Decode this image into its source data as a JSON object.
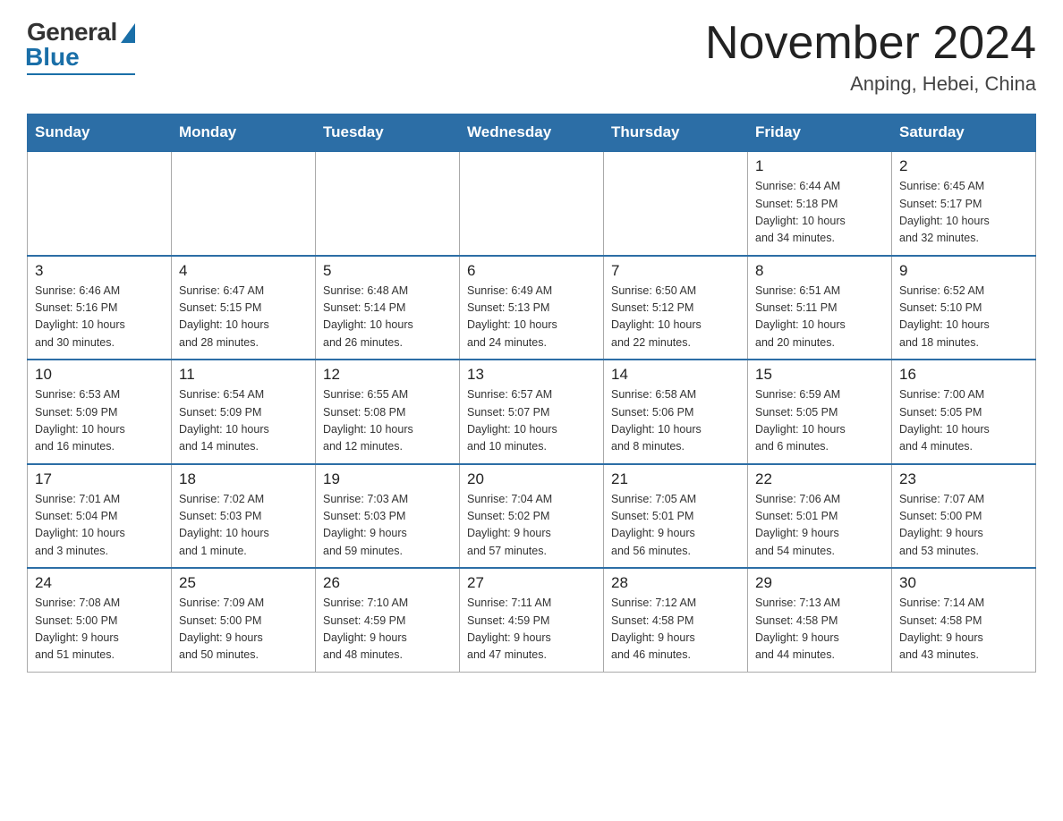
{
  "header": {
    "logo": {
      "general_text": "General",
      "blue_text": "Blue"
    },
    "month_title": "November 2024",
    "location": "Anping, Hebei, China"
  },
  "weekdays": [
    "Sunday",
    "Monday",
    "Tuesday",
    "Wednesday",
    "Thursday",
    "Friday",
    "Saturday"
  ],
  "weeks": [
    [
      {
        "day": "",
        "info": ""
      },
      {
        "day": "",
        "info": ""
      },
      {
        "day": "",
        "info": ""
      },
      {
        "day": "",
        "info": ""
      },
      {
        "day": "",
        "info": ""
      },
      {
        "day": "1",
        "info": "Sunrise: 6:44 AM\nSunset: 5:18 PM\nDaylight: 10 hours\nand 34 minutes."
      },
      {
        "day": "2",
        "info": "Sunrise: 6:45 AM\nSunset: 5:17 PM\nDaylight: 10 hours\nand 32 minutes."
      }
    ],
    [
      {
        "day": "3",
        "info": "Sunrise: 6:46 AM\nSunset: 5:16 PM\nDaylight: 10 hours\nand 30 minutes."
      },
      {
        "day": "4",
        "info": "Sunrise: 6:47 AM\nSunset: 5:15 PM\nDaylight: 10 hours\nand 28 minutes."
      },
      {
        "day": "5",
        "info": "Sunrise: 6:48 AM\nSunset: 5:14 PM\nDaylight: 10 hours\nand 26 minutes."
      },
      {
        "day": "6",
        "info": "Sunrise: 6:49 AM\nSunset: 5:13 PM\nDaylight: 10 hours\nand 24 minutes."
      },
      {
        "day": "7",
        "info": "Sunrise: 6:50 AM\nSunset: 5:12 PM\nDaylight: 10 hours\nand 22 minutes."
      },
      {
        "day": "8",
        "info": "Sunrise: 6:51 AM\nSunset: 5:11 PM\nDaylight: 10 hours\nand 20 minutes."
      },
      {
        "day": "9",
        "info": "Sunrise: 6:52 AM\nSunset: 5:10 PM\nDaylight: 10 hours\nand 18 minutes."
      }
    ],
    [
      {
        "day": "10",
        "info": "Sunrise: 6:53 AM\nSunset: 5:09 PM\nDaylight: 10 hours\nand 16 minutes."
      },
      {
        "day": "11",
        "info": "Sunrise: 6:54 AM\nSunset: 5:09 PM\nDaylight: 10 hours\nand 14 minutes."
      },
      {
        "day": "12",
        "info": "Sunrise: 6:55 AM\nSunset: 5:08 PM\nDaylight: 10 hours\nand 12 minutes."
      },
      {
        "day": "13",
        "info": "Sunrise: 6:57 AM\nSunset: 5:07 PM\nDaylight: 10 hours\nand 10 minutes."
      },
      {
        "day": "14",
        "info": "Sunrise: 6:58 AM\nSunset: 5:06 PM\nDaylight: 10 hours\nand 8 minutes."
      },
      {
        "day": "15",
        "info": "Sunrise: 6:59 AM\nSunset: 5:05 PM\nDaylight: 10 hours\nand 6 minutes."
      },
      {
        "day": "16",
        "info": "Sunrise: 7:00 AM\nSunset: 5:05 PM\nDaylight: 10 hours\nand 4 minutes."
      }
    ],
    [
      {
        "day": "17",
        "info": "Sunrise: 7:01 AM\nSunset: 5:04 PM\nDaylight: 10 hours\nand 3 minutes."
      },
      {
        "day": "18",
        "info": "Sunrise: 7:02 AM\nSunset: 5:03 PM\nDaylight: 10 hours\nand 1 minute."
      },
      {
        "day": "19",
        "info": "Sunrise: 7:03 AM\nSunset: 5:03 PM\nDaylight: 9 hours\nand 59 minutes."
      },
      {
        "day": "20",
        "info": "Sunrise: 7:04 AM\nSunset: 5:02 PM\nDaylight: 9 hours\nand 57 minutes."
      },
      {
        "day": "21",
        "info": "Sunrise: 7:05 AM\nSunset: 5:01 PM\nDaylight: 9 hours\nand 56 minutes."
      },
      {
        "day": "22",
        "info": "Sunrise: 7:06 AM\nSunset: 5:01 PM\nDaylight: 9 hours\nand 54 minutes."
      },
      {
        "day": "23",
        "info": "Sunrise: 7:07 AM\nSunset: 5:00 PM\nDaylight: 9 hours\nand 53 minutes."
      }
    ],
    [
      {
        "day": "24",
        "info": "Sunrise: 7:08 AM\nSunset: 5:00 PM\nDaylight: 9 hours\nand 51 minutes."
      },
      {
        "day": "25",
        "info": "Sunrise: 7:09 AM\nSunset: 5:00 PM\nDaylight: 9 hours\nand 50 minutes."
      },
      {
        "day": "26",
        "info": "Sunrise: 7:10 AM\nSunset: 4:59 PM\nDaylight: 9 hours\nand 48 minutes."
      },
      {
        "day": "27",
        "info": "Sunrise: 7:11 AM\nSunset: 4:59 PM\nDaylight: 9 hours\nand 47 minutes."
      },
      {
        "day": "28",
        "info": "Sunrise: 7:12 AM\nSunset: 4:58 PM\nDaylight: 9 hours\nand 46 minutes."
      },
      {
        "day": "29",
        "info": "Sunrise: 7:13 AM\nSunset: 4:58 PM\nDaylight: 9 hours\nand 44 minutes."
      },
      {
        "day": "30",
        "info": "Sunrise: 7:14 AM\nSunset: 4:58 PM\nDaylight: 9 hours\nand 43 minutes."
      }
    ]
  ]
}
